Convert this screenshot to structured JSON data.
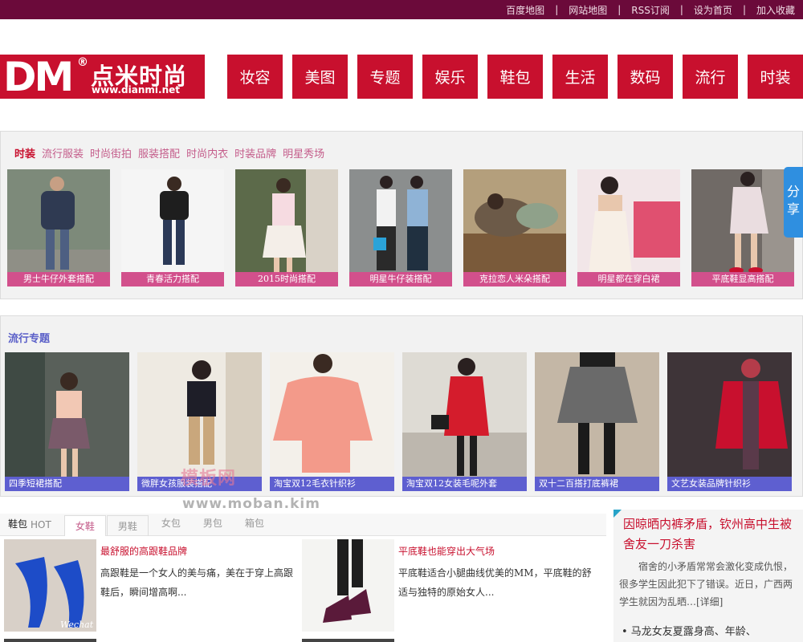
{
  "top_links": [
    "百度地图",
    "网站地图",
    "RSS订阅",
    "设为首页",
    "加入收藏"
  ],
  "top_sep": "|",
  "logo": {
    "letters": "DM",
    "reg": "®",
    "cn": "点米时尚",
    "url": "www.dianmi.net"
  },
  "nav": [
    "妆容",
    "美图",
    "专题",
    "娱乐",
    "鞋包",
    "生活",
    "数码",
    "流行",
    "时装"
  ],
  "fashion": {
    "main": "时装",
    "subs": [
      "流行服装",
      "时尚街拍",
      "服装搭配",
      "时尚内衣",
      "时装品牌",
      "明星秀场"
    ],
    "cards": [
      "男士牛仔外套搭配",
      "青春活力搭配",
      "2015时尚搭配",
      "明星牛仔装搭配",
      "克拉恋人米朵搭配",
      "明星都在穿白裙",
      "平底鞋显高搭配"
    ]
  },
  "share": "分享",
  "topics": {
    "title": "流行专题",
    "cards": [
      "四季短裙搭配",
      "微胖女孩服装搭配",
      "淘宝双12毛衣针织衫",
      "淘宝双12女装毛呢外套",
      "双十二百搭打底裤裙",
      "文艺女装品牌针织衫"
    ]
  },
  "watermark": {
    "big": "模板网",
    "url": "www.moban.kim"
  },
  "shoes": {
    "label": "鞋包",
    "hot": "HOT",
    "tabs": [
      "女鞋",
      "男鞋",
      "女包",
      "男包",
      "箱包"
    ],
    "articles": [
      {
        "title": "最舒服的高跟鞋品牌",
        "desc": "高跟鞋是一个女人的美与痛，美在于穿上高跟鞋后，瞬间增高啊..."
      },
      {
        "title": "平底鞋也能穿出大气场",
        "desc": "平底鞋适合小腿曲线优美的MM，平底鞋的舒适与独特的原始女人..."
      }
    ],
    "photo_tag": "Wechat"
  },
  "sidebar": {
    "headline": "因晾晒内裤矛盾，钦州高中生被舍友一刀杀害",
    "summary": "宿舍的小矛盾常常会激化变成仇恨，很多学生因此犯下了错误。近日，广西两学生就因为乱晒…[详细]",
    "bullet": "• 马龙女友夏露身高、年龄、"
  }
}
